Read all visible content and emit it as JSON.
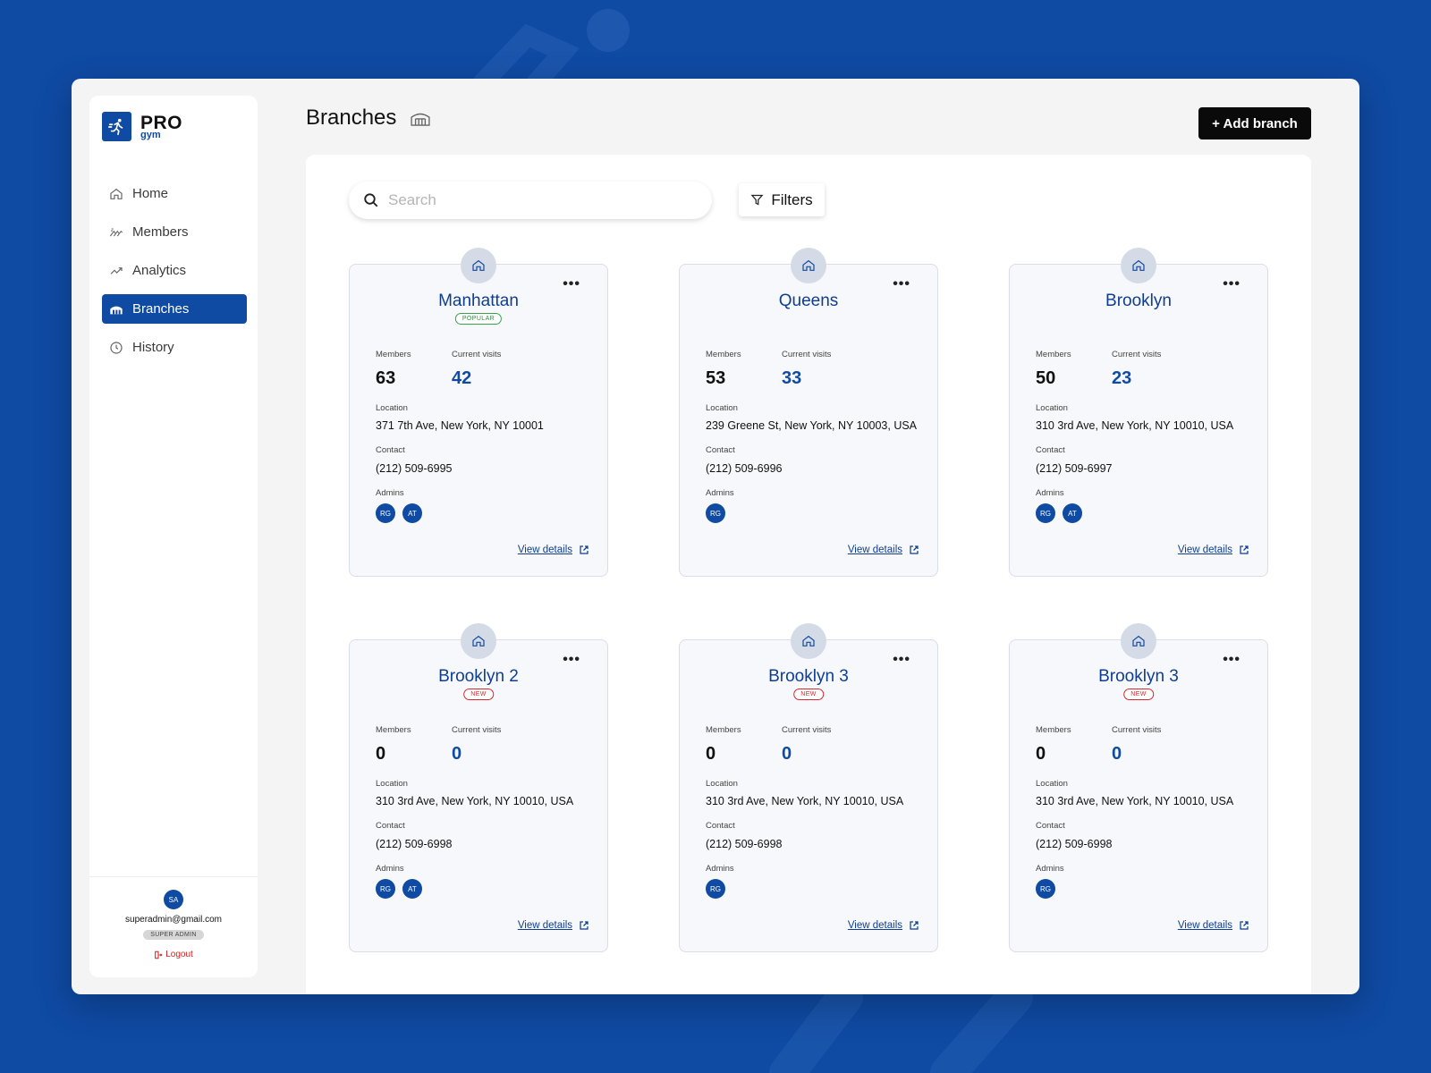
{
  "brand": {
    "name": "PRO",
    "sub": "gym"
  },
  "sidebar": {
    "items": [
      {
        "label": "Home",
        "icon": "home-icon",
        "active": false
      },
      {
        "label": "Members",
        "icon": "members-icon",
        "active": false
      },
      {
        "label": "Analytics",
        "icon": "analytics-icon",
        "active": false
      },
      {
        "label": "Branches",
        "icon": "branches-icon",
        "active": true
      },
      {
        "label": "History",
        "icon": "history-icon",
        "active": false
      }
    ],
    "user": {
      "initials": "SA",
      "email": "superadmin@gmail.com",
      "role": "SUPER ADMIN",
      "logout": "Logout"
    }
  },
  "header": {
    "title": "Branches",
    "add_button": "+ Add branch"
  },
  "toolbar": {
    "search_placeholder": "Search",
    "filters_label": "Filters"
  },
  "labels": {
    "members": "Members",
    "visits": "Current visits",
    "location": "Location",
    "contact": "Contact",
    "admins": "Admins",
    "view_details": "View details"
  },
  "branches": [
    {
      "name": "Manhattan",
      "badge": "POPULAR",
      "members": "63",
      "visits": "42",
      "location": "371 7th Ave, New York, NY 10001",
      "contact": "(212) 509-6995",
      "admins": [
        "RG",
        "AT"
      ]
    },
    {
      "name": "Queens",
      "badge": "",
      "members": "53",
      "visits": "33",
      "location": "239 Greene St, New York, NY 10003, USA",
      "contact": "(212) 509-6996",
      "admins": [
        "RG"
      ]
    },
    {
      "name": "Brooklyn",
      "badge": "",
      "members": "50",
      "visits": "23",
      "location": "310 3rd Ave, New York, NY 10010, USA",
      "contact": "(212) 509-6997",
      "admins": [
        "RG",
        "AT"
      ]
    },
    {
      "name": "Brooklyn 2",
      "badge": "NEW",
      "members": "0",
      "visits": "0",
      "location": "310 3rd Ave, New York, NY 10010, USA",
      "contact": "(212) 509-6998",
      "admins": [
        "RG",
        "AT"
      ]
    },
    {
      "name": "Brooklyn 3",
      "badge": "NEW",
      "members": "0",
      "visits": "0",
      "location": "310 3rd Ave, New York, NY 10010, USA",
      "contact": "(212) 509-6998",
      "admins": [
        "RG"
      ]
    },
    {
      "name": "Brooklyn 3",
      "badge": "NEW",
      "members": "0",
      "visits": "0",
      "location": "310 3rd Ave, New York, NY 10010, USA",
      "contact": "(212) 509-6998",
      "admins": [
        "RG"
      ]
    }
  ],
  "colors": {
    "accent": "#0f4aa3",
    "background": "#0f4aa3",
    "popular": "#2e8c3c",
    "new": "#d9272e"
  }
}
